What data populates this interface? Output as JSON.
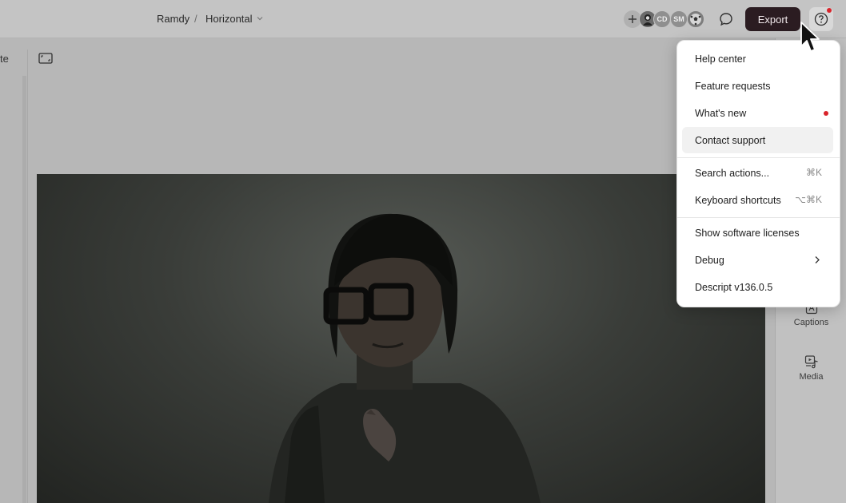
{
  "header": {
    "breadcrumb_project": "Ramdy",
    "breadcrumb_separator": "/",
    "breadcrumb_composition": "Horizontal",
    "avatars": [
      {
        "initials": "",
        "icon": "illustrated-avatar",
        "color": "#6a6a6a"
      },
      {
        "initials": "CD",
        "color": "#8f8f8f"
      },
      {
        "initials": "SM",
        "color": "#8f8f8f"
      },
      {
        "initials": "",
        "icon": "ball-avatar",
        "color": "#7d7d7d"
      }
    ],
    "export_label": "Export",
    "help_notification": true
  },
  "left_panel": {
    "truncated_label": "te"
  },
  "right_panel": {
    "items": [
      {
        "label": "Captions",
        "icon": "captions-icon"
      },
      {
        "label": "Media",
        "icon": "media-icon"
      }
    ]
  },
  "help_menu": {
    "items": [
      {
        "label": "Help center"
      },
      {
        "label": "Feature requests"
      },
      {
        "label": "What's new",
        "badge": true
      },
      {
        "label": "Contact support",
        "active": true
      },
      {
        "label": "Search actions...",
        "shortcut": "⌘K"
      },
      {
        "label": "Keyboard shortcuts",
        "shortcut": "⌥⌘K"
      },
      {
        "label": "Show software licenses"
      },
      {
        "label": "Debug",
        "submenu": true
      },
      {
        "label": "Descript v136.0.5"
      }
    ]
  },
  "colors": {
    "export_button": "#2b1c21",
    "notification_dot": "#d9242b",
    "overlay": "#b7b7b7"
  }
}
